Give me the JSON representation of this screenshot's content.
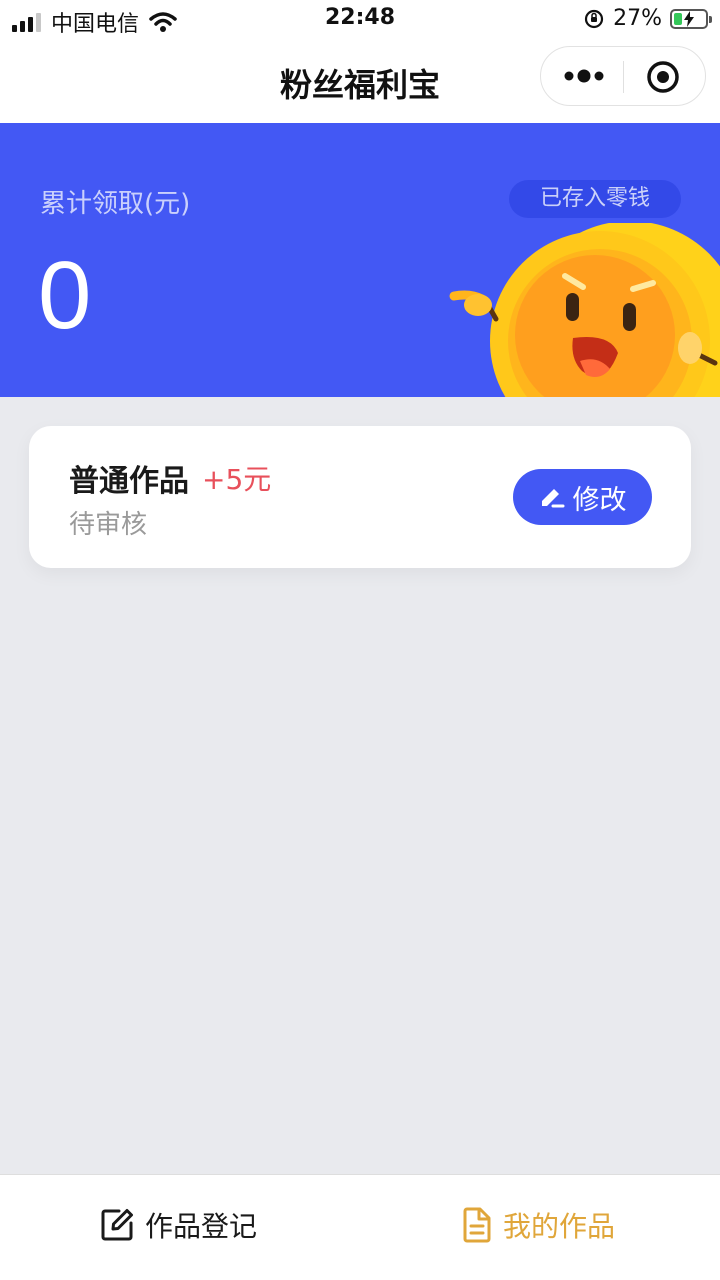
{
  "status_bar": {
    "carrier": "中国电信",
    "time": "22:48",
    "battery_percent_text": "27%",
    "battery_level": 0.27
  },
  "nav": {
    "title": "粉丝福利宝"
  },
  "banner": {
    "label": "累计领取(元)",
    "badge": "已存入零钱",
    "amount": "0"
  },
  "works": [
    {
      "title": "普通作品",
      "reward": "+5元",
      "status": "待审核",
      "edit_label": "修改"
    }
  ],
  "tab_bar": {
    "tabs": [
      {
        "label": "作品登记",
        "icon": "edit-square-icon",
        "active": false
      },
      {
        "label": "我的作品",
        "icon": "document-icon",
        "active": true
      }
    ],
    "active_color": "#e0a63a"
  },
  "colors": {
    "primary": "#4358f4",
    "reward": "#e8505b",
    "background": "#e9eaee"
  }
}
